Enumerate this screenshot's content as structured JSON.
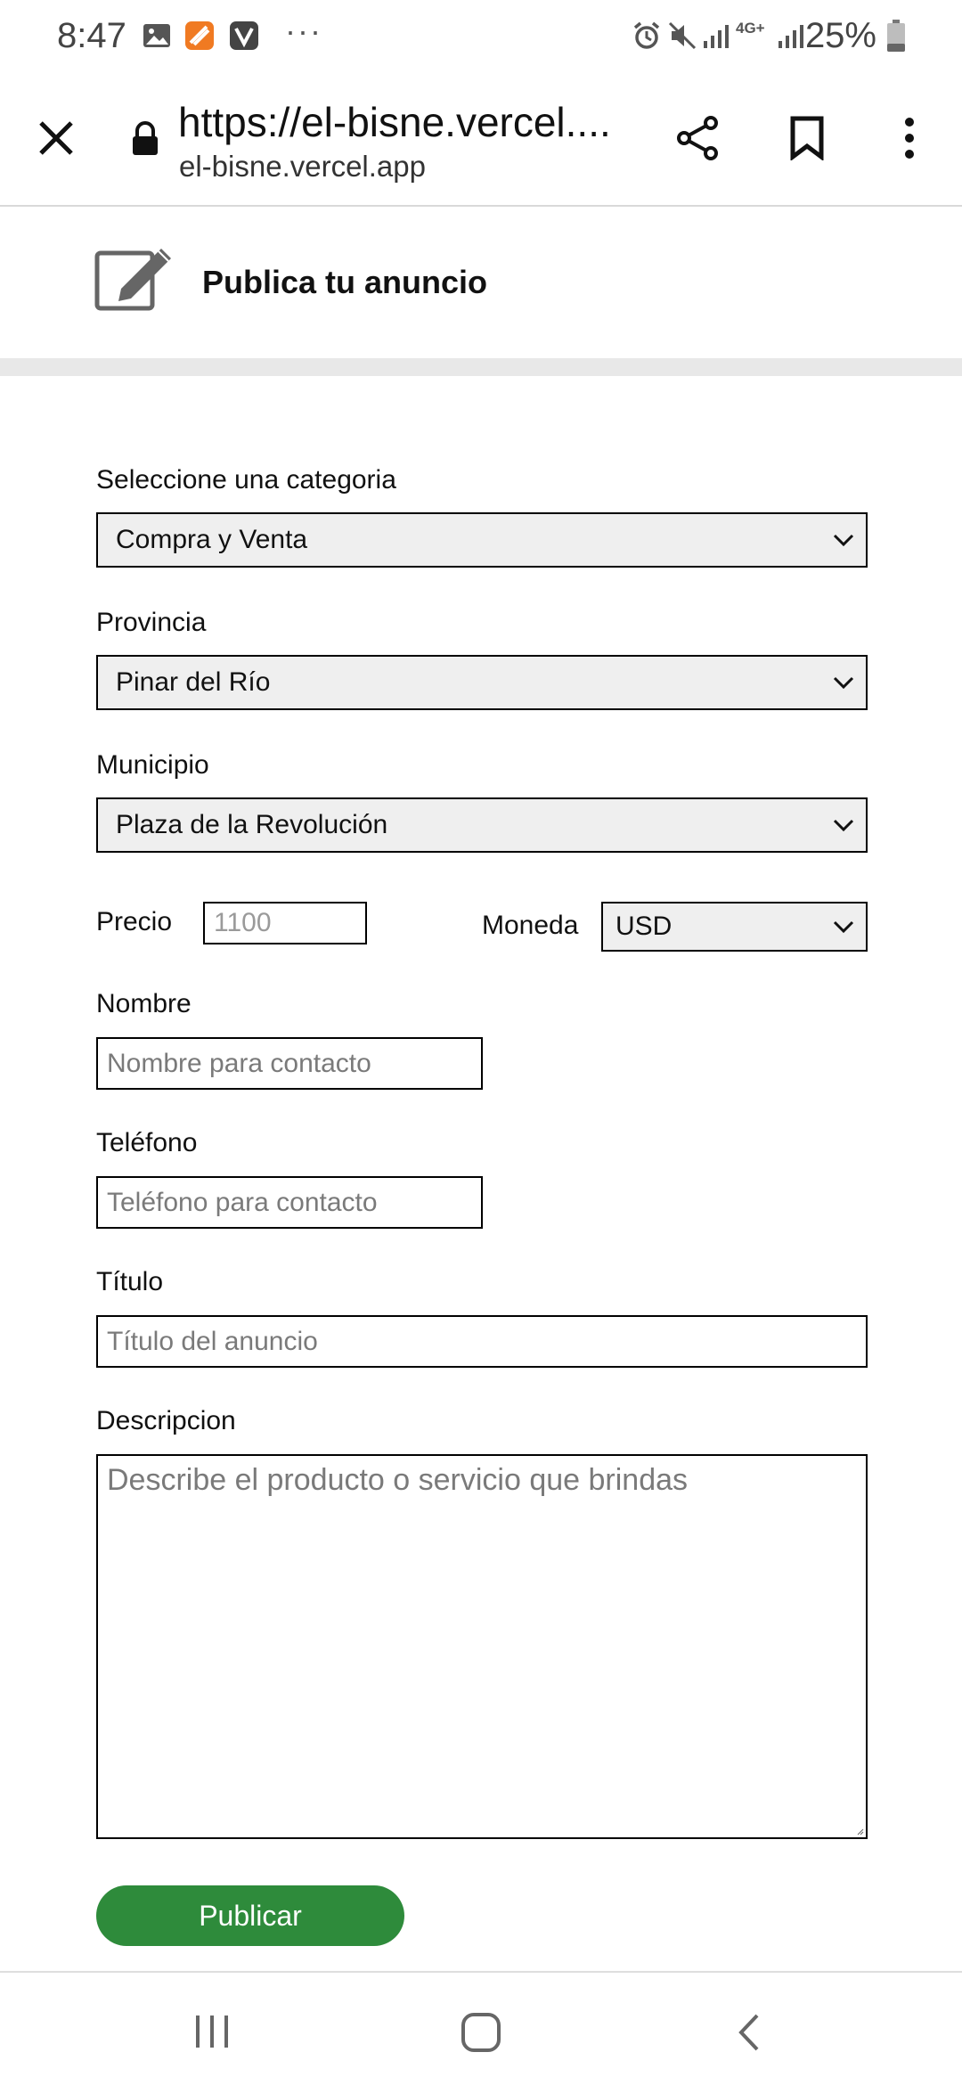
{
  "status_bar": {
    "time": "8:47",
    "more": "···",
    "battery": "25%",
    "network": "4G+"
  },
  "browser": {
    "url": "https://el-bisne.vercel....",
    "domain": "el-bisne.vercel.app"
  },
  "header": {
    "title": "Publica tu anuncio"
  },
  "form": {
    "category_label": "Seleccione una categoria",
    "category_value": "Compra y Venta",
    "province_label": "Provincia",
    "province_value": "Pinar del Río",
    "municipality_label": "Municipio",
    "municipality_value": "Plaza de la Revolución",
    "price_label": "Precio",
    "price_placeholder": "1100",
    "currency_label": "Moneda",
    "currency_value": "USD",
    "name_label": "Nombre",
    "name_placeholder": "Nombre para contacto",
    "phone_label": "Teléfono",
    "phone_placeholder": "Teléfono para contacto",
    "title_label": "Título",
    "title_placeholder": "Título del anuncio",
    "description_label": "Descripcion",
    "description_placeholder": "Describe el producto o servicio que brindas",
    "submit_label": "Publicar"
  },
  "colors": {
    "accent_button": "#2e8b3b",
    "select_bg": "#efefef"
  }
}
